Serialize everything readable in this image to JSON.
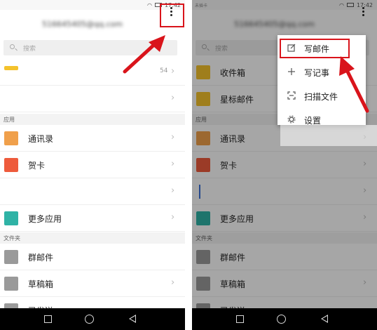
{
  "status": {
    "carrier_right": "未插卡",
    "time": "17:42"
  },
  "header": {
    "account_email": "516645405@qq.com"
  },
  "search": {
    "placeholder": "搜索"
  },
  "left": {
    "top_items": [
      {
        "label": "",
        "count": "54"
      },
      {
        "label": "",
        "count": ""
      }
    ],
    "section_apps": "应用",
    "apps": [
      {
        "label": "通讯录"
      },
      {
        "label": "贺卡"
      },
      {
        "label": ""
      },
      {
        "label": "更多应用"
      }
    ],
    "section_folders": "文件夹",
    "folders": [
      {
        "label": "群邮件"
      },
      {
        "label": "草稿箱"
      },
      {
        "label": "已发送"
      }
    ]
  },
  "right": {
    "top_items": [
      {
        "label": "收件箱"
      },
      {
        "label": "星标邮件"
      }
    ],
    "section_apps": "应用",
    "apps": [
      {
        "label": "通讯录"
      },
      {
        "label": "贺卡"
      },
      {
        "label": ""
      },
      {
        "label": "更多应用"
      }
    ],
    "section_folders": "文件夹",
    "folders": [
      {
        "label": "群邮件"
      },
      {
        "label": "草稿箱"
      },
      {
        "label": "已发送"
      }
    ],
    "menu": [
      {
        "label": "写邮件",
        "icon": "compose-icon"
      },
      {
        "label": "写记事",
        "icon": "plus-icon"
      },
      {
        "label": "扫描文件",
        "icon": "scan-icon"
      },
      {
        "label": "设置",
        "icon": "gear-icon"
      }
    ]
  },
  "colors": {
    "highlight_red": "#d9141b",
    "contacts_orange": "#f0a04b",
    "card_red": "#ee5b3c",
    "more_apps_teal": "#2fb3a6",
    "folder_gray": "#9a9a9a",
    "inbox_yellow": "#f4c22c"
  }
}
